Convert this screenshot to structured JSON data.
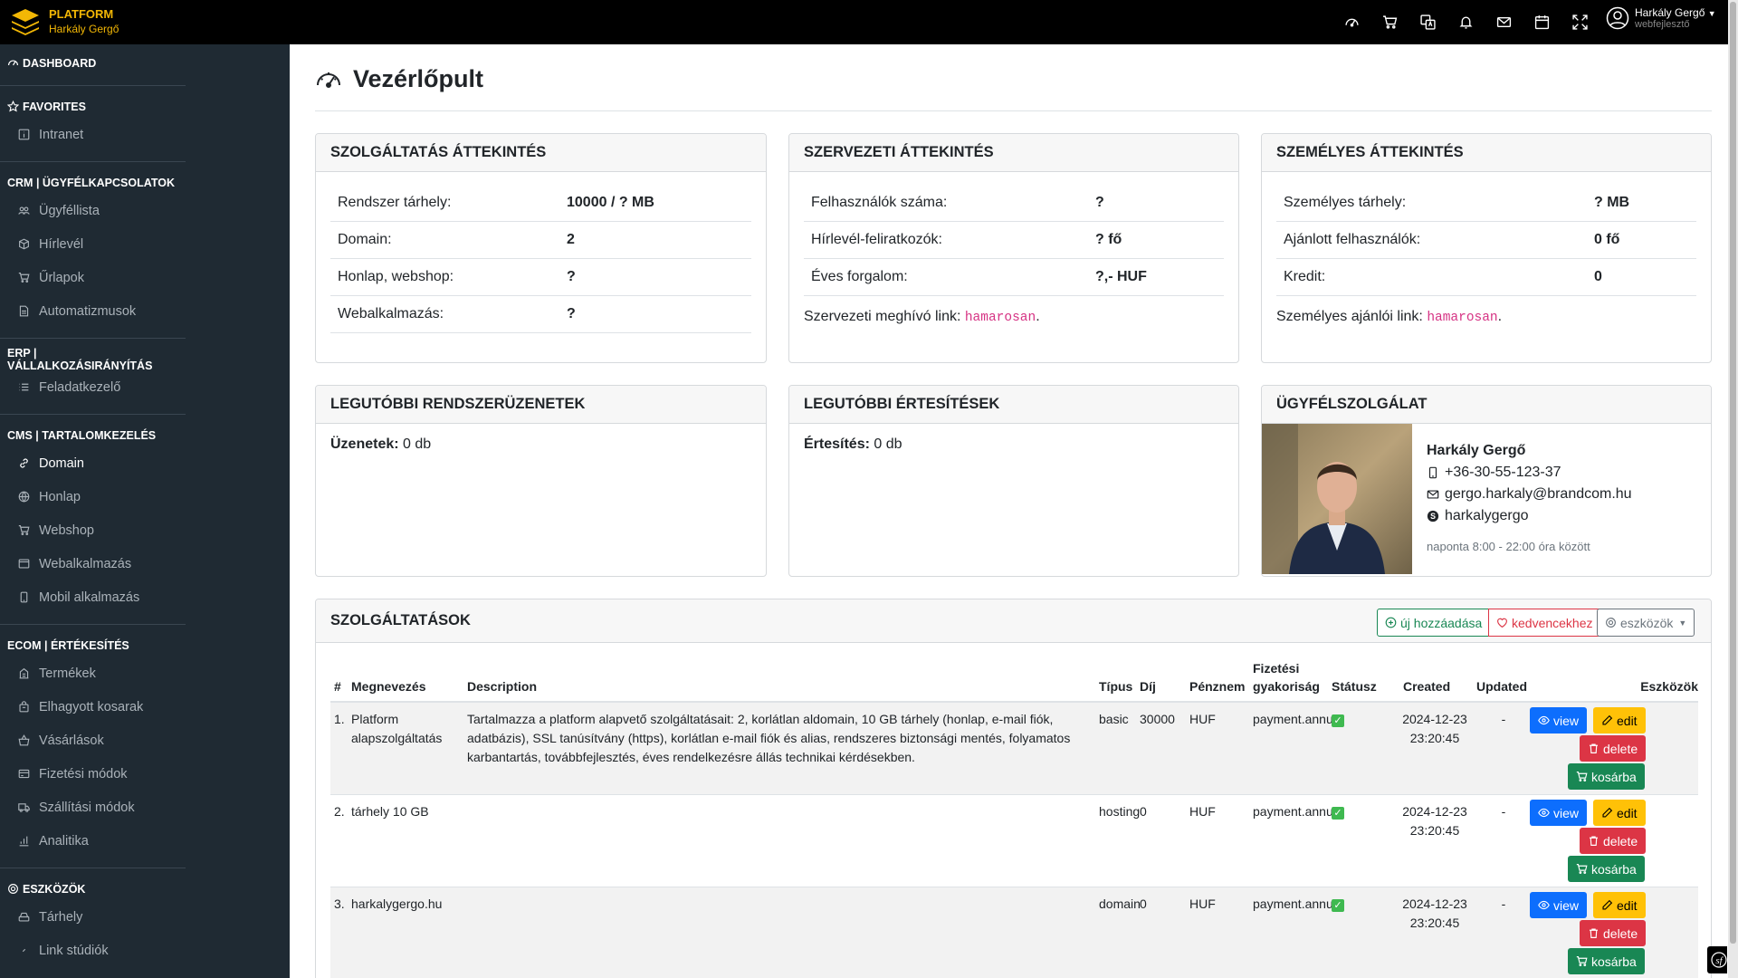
{
  "brand": {
    "title": "PLATFORM",
    "subtitle": "Harkály Gergő"
  },
  "topbar": {
    "icons": [
      "dashboard-icon",
      "cart-icon",
      "translate-icon",
      "bell-icon",
      "mail-icon",
      "calendar-icon",
      "fullscreen-icon"
    ],
    "user_name": "Harkály Gergő",
    "user_role": "webfejlesztő"
  },
  "sidebar": {
    "dashboard": "DASHBOARD",
    "favorites": {
      "title": "FAVORITES",
      "items": [
        "Intranet"
      ]
    },
    "crm": {
      "title": "CRM | ÜGYFÉLKAPCSOLATOK",
      "items": [
        "Ügyféllista",
        "Hírlevél",
        "Űrlapok",
        "Automatizmusok"
      ]
    },
    "erp": {
      "title": "ERP | VÁLLALKOZÁSIRÁNYÍTÁS",
      "items": [
        "Feladatkezelő"
      ]
    },
    "cms": {
      "title": "CMS | TARTALOMKEZELÉS",
      "items": [
        "Domain",
        "Honlap",
        "Webshop",
        "Webalkalmazás",
        "Mobil alkalmazás"
      ]
    },
    "ecom": {
      "title": "ECOM | ÉRTÉKESÍTÉS",
      "items": [
        "Termékek",
        "Elhagyott kosarak",
        "Vásárlások",
        "Fizetési módok",
        "Szállítási módok",
        "Analitika"
      ]
    },
    "tools": {
      "title": "ESZKÖZÖK",
      "items": [
        "Tárhely",
        "Link stúdiók"
      ]
    }
  },
  "page": {
    "title": "Vezérlőpult"
  },
  "service_overview": {
    "title": "SZOLGÁLTATÁS ÁTTEKINTÉS",
    "rows": [
      {
        "k": "Rendszer tárhely:",
        "v": "10000 / ? MB"
      },
      {
        "k": "Domain:",
        "v": "2"
      },
      {
        "k": "Honlap, webshop:",
        "v": "?"
      },
      {
        "k": "Webalkalmazás:",
        "v": "?"
      }
    ]
  },
  "org_overview": {
    "title": "SZERVEZETI ÁTTEKINTÉS",
    "rows": [
      {
        "k": "Felhasználók száma:",
        "v": "?"
      },
      {
        "k": "Hírlevél-feliratkozók:",
        "v": "? fő"
      },
      {
        "k": "Éves forgalom:",
        "v": "?,- HUF"
      }
    ],
    "invite_label": "Szervezeti meghívó link:",
    "invite_value": "hamarosan"
  },
  "personal_overview": {
    "title": "SZEMÉLYES ÁTTEKINTÉS",
    "rows": [
      {
        "k": "Személyes tárhely:",
        "v": "? MB"
      },
      {
        "k": "Ajánlott felhasználók:",
        "v": "0 fő"
      },
      {
        "k": "Kredit:",
        "v": "0"
      }
    ],
    "invite_label": "Személyes ajánlói link:",
    "invite_value": "hamarosan"
  },
  "system_messages": {
    "title": "LEGUTÓBBI RENDSZERÜZENETEK",
    "label": "Üzenetek:",
    "value": "0 db"
  },
  "notifications": {
    "title": "LEGUTÓBBI ÉRTESÍTÉSEK",
    "label": "Értesítés:",
    "value": "0 db"
  },
  "support": {
    "title": "ÜGYFÉLSZOLGÁLAT",
    "name": "Harkály Gergő",
    "phone": "+36-30-55-123-37",
    "email": "gergo.harkaly@brandcom.hu",
    "skype": "harkalygergo",
    "hours": "naponta 8:00 - 22:00 óra között"
  },
  "services": {
    "title": "SZOLGÁLTATÁSOK",
    "add_label": "új hozzáadása",
    "fav_label": "kedvencekhez",
    "tools_label": "eszközök",
    "columns": {
      "num": "#",
      "name": "Megnevezés",
      "desc": "Description",
      "type": "Típus",
      "fee": "Díj",
      "currency": "Pénznem",
      "freq": "Fizetési gyakoriság",
      "status": "Státusz",
      "created": "Created",
      "updated": "Updated",
      "tools": "Eszközök"
    },
    "buttons": {
      "view": "view",
      "edit": "edit",
      "delete": "delete",
      "cart": "kosárba"
    },
    "rows": [
      {
        "num": "1.",
        "name": "Platform alapszolgáltatás",
        "desc": "Tartalmazza a platform alapvető szolgáltatásait: 2, korlátlan aldomain, 10 GB tárhely (honlap, e-mail fiók, adatbázis), SSL tanúsítvány (https), korlátlan e-mail fiók és alias, rendszeres biztonsági mentés, folyamatos karbantartás, továbbfejlesztés, éves rendelkezésre állás technikai kérdésekben.",
        "type": "basic",
        "fee": "30000",
        "currency": "HUF",
        "freq": "payment.annual",
        "created": "2024-12-23 23:20:45",
        "updated": "-"
      },
      {
        "num": "2.",
        "name": "tárhely 10 GB",
        "desc": "",
        "type": "hosting",
        "fee": "0",
        "currency": "HUF",
        "freq": "payment.annual",
        "created": "2024-12-23 23:20:45",
        "updated": "-"
      },
      {
        "num": "3.",
        "name": "harkalygergo.hu",
        "desc": "",
        "type": "domain",
        "fee": "0",
        "currency": "HUF",
        "freq": "payment.annual",
        "created": "2024-12-23 23:20:45",
        "updated": "-"
      }
    ]
  }
}
